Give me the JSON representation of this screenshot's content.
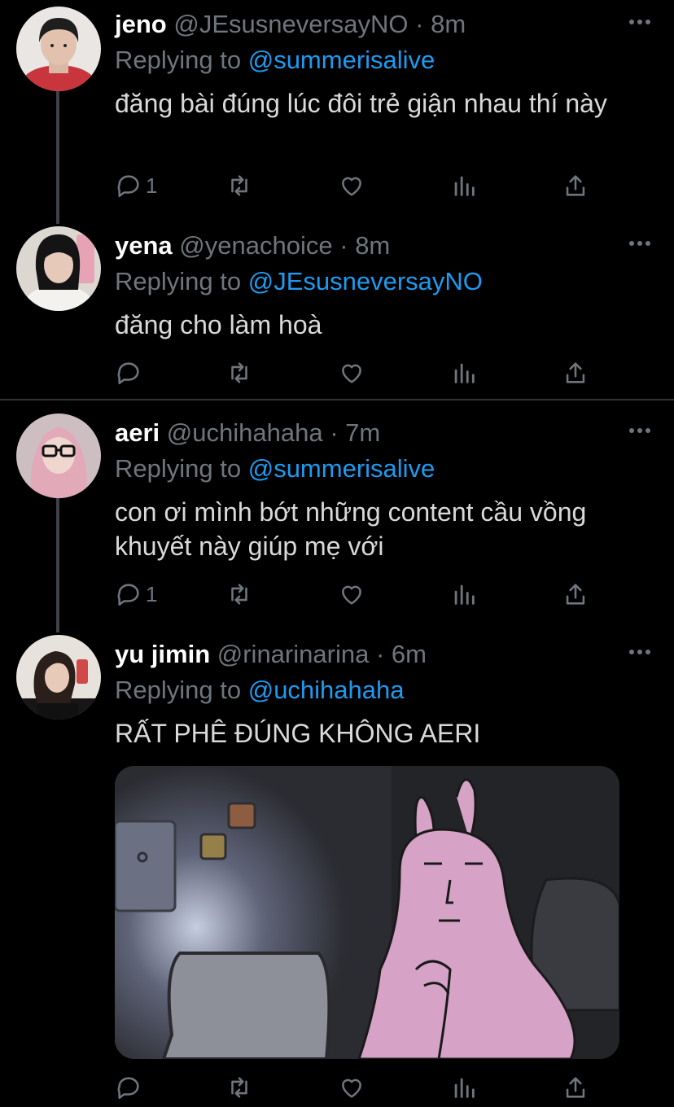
{
  "tweets": [
    {
      "name": "jeno",
      "handle": "@JEsusneversayNO",
      "time": "8m",
      "reply_prefix": "Replying to",
      "reply_to": "@summerisalive",
      "text": "đăng bài đúng lúc đôi trẻ giận nhau thí này",
      "reply_count": "1"
    },
    {
      "name": "yena",
      "handle": "@yenachoice",
      "time": "8m",
      "reply_prefix": "Replying to",
      "reply_to": "@JEsusneversayNO",
      "text": "đăng cho làm hoà",
      "reply_count": ""
    },
    {
      "name": "aeri",
      "handle": "@uchihahaha",
      "time": "7m",
      "reply_prefix": "Replying to",
      "reply_to": "@summerisalive",
      "text": "con ơi mình bớt những content cầu vồng khuyết này giúp mẹ với",
      "reply_count": "1"
    },
    {
      "name": "yu jimin",
      "handle": "@rinarinarina",
      "time": "6m",
      "reply_prefix": "Replying to",
      "reply_to": "@uchihahaha",
      "text": "RẤT PHÊ ĐÚNG KHÔNG AERI",
      "reply_count": ""
    }
  ],
  "separator_dot": "·",
  "icons": {
    "more": "more-horizontal-icon",
    "reply": "reply-bubble-icon",
    "retweet": "retweet-icon",
    "like": "heart-icon",
    "analytics": "analytics-bars-icon",
    "share": "share-upload-icon"
  },
  "colors": {
    "background": "#000000",
    "text": "#d9d9d9",
    "name": "#ffffff",
    "secondary": "#6e767d",
    "mention": "#1d9bf0",
    "divider": "#2f3336"
  }
}
